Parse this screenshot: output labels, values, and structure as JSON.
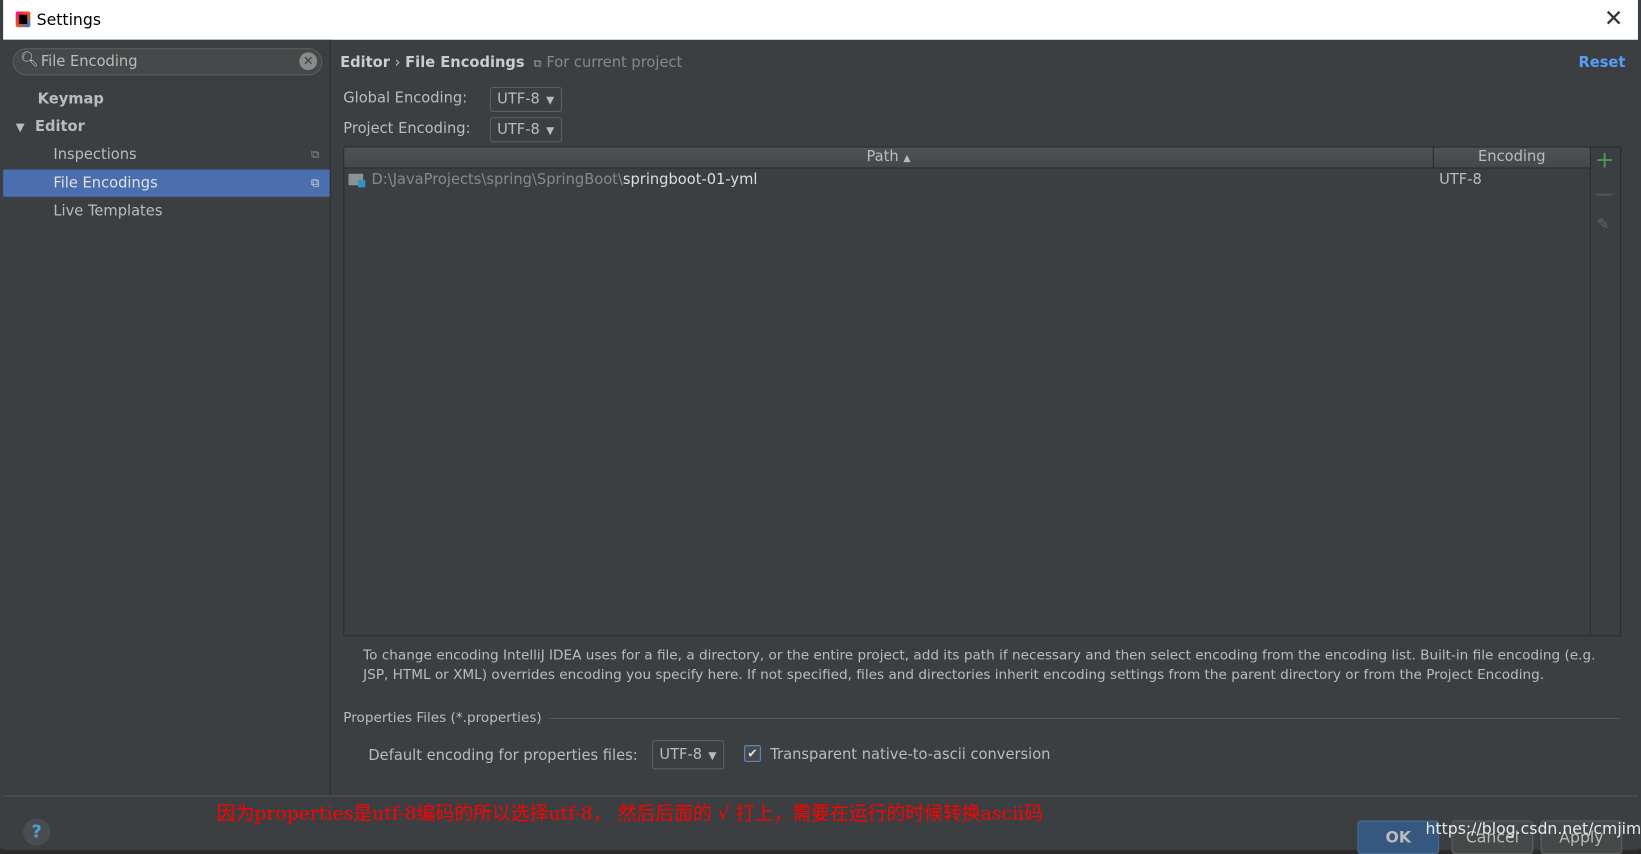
{
  "window": {
    "title": "Settings"
  },
  "search": {
    "value": "File Encoding"
  },
  "sidebar": {
    "items": [
      {
        "label": "Keymap"
      },
      {
        "label": "Editor"
      },
      {
        "label": "Inspections"
      },
      {
        "label": "File Encodings"
      },
      {
        "label": "Live Templates"
      }
    ]
  },
  "breadcrumb": {
    "parent": "Editor",
    "sep": "›",
    "current": "File Encodings",
    "scope": "For current project"
  },
  "reset_label": "Reset",
  "global_encoding": {
    "label": "Global Encoding:",
    "value": "UTF-8"
  },
  "project_encoding": {
    "label": "Project Encoding:",
    "value": "UTF-8"
  },
  "table": {
    "columns": [
      "Path",
      "Encoding"
    ],
    "sort_indicator": "▲",
    "rows": [
      {
        "path_prefix": "D:\\JavaProjects\\spring\\SpringBoot\\",
        "path_name": "springboot-01-yml",
        "encoding": "UTF-8"
      }
    ]
  },
  "help_text": "To change encoding IntelliJ IDEA uses for a file, a directory, or the entire project, add its path if necessary and then select encoding from the encoding list. Built-in file encoding (e.g. JSP, HTML or XML) overrides encoding you specify here. If not specified, files and directories inherit encoding settings from the parent directory or from the Project Encoding.",
  "properties": {
    "section": "Properties Files (*.properties)",
    "default_label": "Default encoding for properties files:",
    "default_value": "UTF-8",
    "transparent_label": "Transparent native-to-ascii conversion",
    "transparent_checked": true
  },
  "annotation": "因为properties是utf-8编码的所以选择utf-8， 然后后面的 √ 打上，需要在运行的时候转换ascii码",
  "watermark": "https://blog.csdn.net/cmjimmy",
  "buttons": {
    "ok": "OK",
    "cancel": "Cancel",
    "apply": "Apply",
    "help": "?"
  },
  "colors": {
    "accent": "#4b6eaf",
    "link": "#589df6",
    "annotation": "#ff0000",
    "add": "#499c54"
  }
}
